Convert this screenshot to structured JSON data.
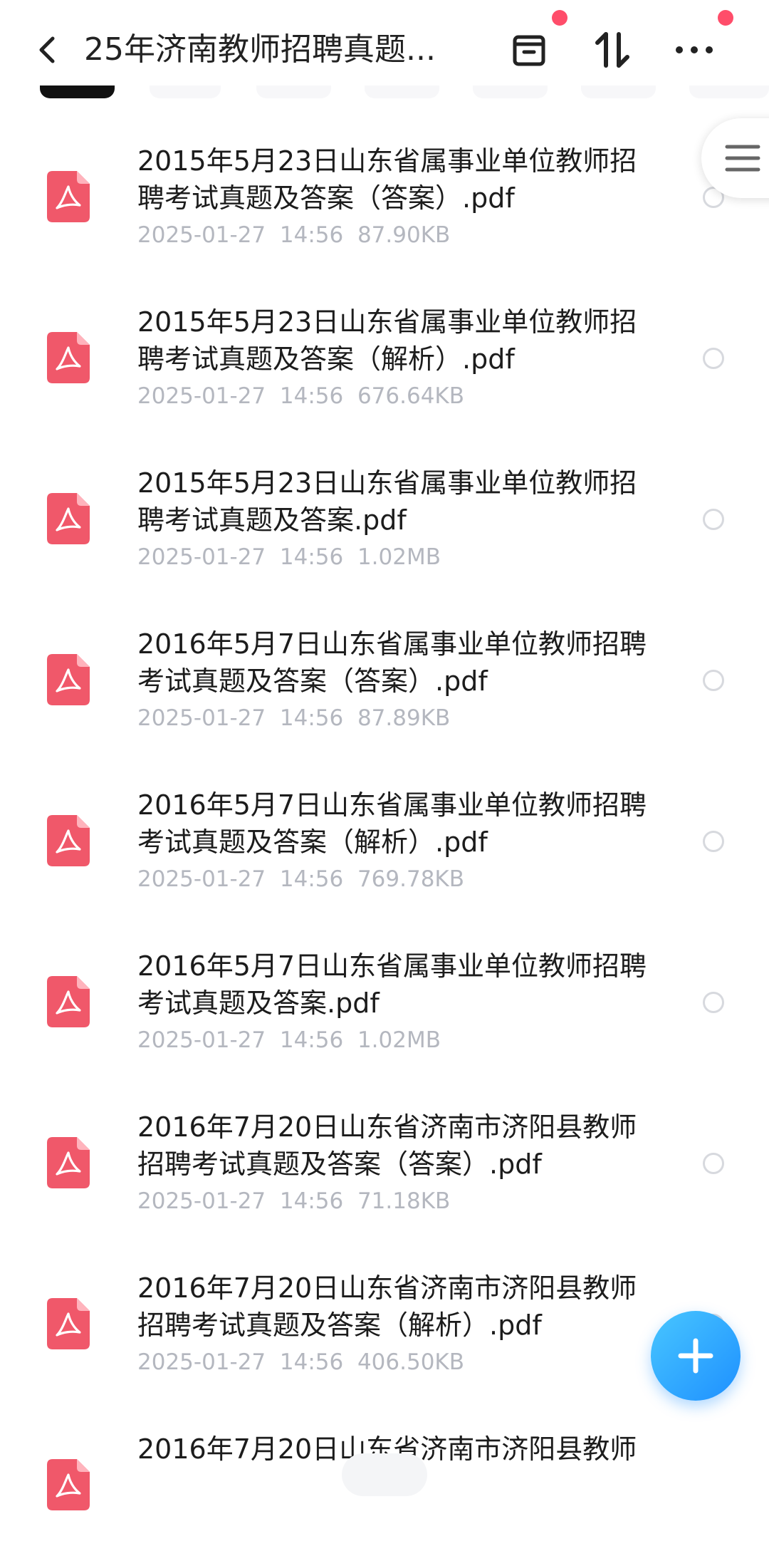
{
  "header": {
    "title": "25年济南教师招聘真题...",
    "back_icon": "chevron-left-icon",
    "archive_icon": "archive-icon",
    "sort_icon": "sort-icon",
    "more_icon": "more-horizontal-icon",
    "badge_color": "#ff4d6a"
  },
  "colors": {
    "pdf": "#f0586a",
    "fab": "#1e90ff",
    "meta_text": "#b4b7bf"
  },
  "files": [
    {
      "name": "2015年5月23日山东省属事业单位教师招聘考试真题及答案（答案）.pdf",
      "date": "2025-01-27",
      "time": "14:56",
      "size": "87.90KB"
    },
    {
      "name": "2015年5月23日山东省属事业单位教师招聘考试真题及答案（解析）.pdf",
      "date": "2025-01-27",
      "time": "14:56",
      "size": "676.64KB"
    },
    {
      "name": "2015年5月23日山东省属事业单位教师招聘考试真题及答案.pdf",
      "date": "2025-01-27",
      "time": "14:56",
      "size": "1.02MB"
    },
    {
      "name": "2016年5月7日山东省属事业单位教师招聘考试真题及答案（答案）.pdf",
      "date": "2025-01-27",
      "time": "14:56",
      "size": "87.89KB"
    },
    {
      "name": "2016年5月7日山东省属事业单位教师招聘考试真题及答案（解析）.pdf",
      "date": "2025-01-27",
      "time": "14:56",
      "size": "769.78KB"
    },
    {
      "name": "2016年5月7日山东省属事业单位教师招聘考试真题及答案.pdf",
      "date": "2025-01-27",
      "time": "14:56",
      "size": "1.02MB"
    },
    {
      "name": "2016年7月20日山东省济南市济阳县教师招聘考试真题及答案（答案）.pdf",
      "date": "2025-01-27",
      "time": "14:56",
      "size": "71.18KB"
    },
    {
      "name": "2016年7月20日山东省济南市济阳县教师招聘考试真题及答案（解析）.pdf",
      "date": "2025-01-27",
      "time": "14:56",
      "size": "406.50KB"
    },
    {
      "name": "2016年7月20日山东省济南市济阳县教师",
      "date": "",
      "time": "",
      "size": ""
    }
  ]
}
